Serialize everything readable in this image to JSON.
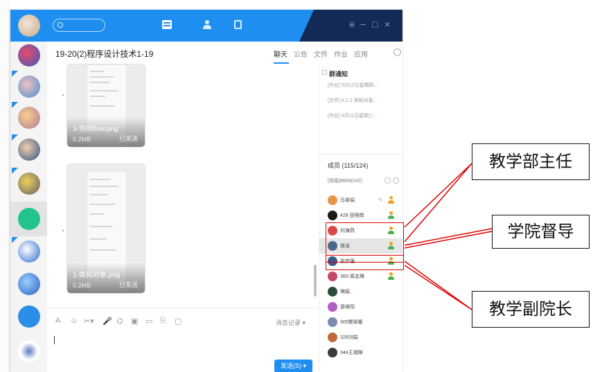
{
  "window": {
    "title": "19-20(2)程序设计技术1-19",
    "window_controls": [
      "≡",
      "−",
      "□",
      "×"
    ]
  },
  "tabs": [
    {
      "label": "聊天",
      "active": true
    },
    {
      "label": "公告",
      "active": false
    },
    {
      "label": "文件",
      "active": false
    },
    {
      "label": "作业",
      "active": false
    },
    {
      "label": "应用",
      "active": false
    }
  ],
  "messages": [
    {
      "filename": "3-协同flow.png",
      "size": "0.2MB",
      "status": "已发送"
    },
    {
      "filename": "1-类和对象.png",
      "size": "0.2MB",
      "status": "已发送"
    }
  ],
  "toolbar": {
    "icons": [
      "A",
      "☺",
      "✂▾",
      "🎤",
      "⌬",
      "▣",
      "▭",
      "⎘",
      "▢"
    ],
    "history_label": "消息记录 ▾",
    "send_label": "发送(S) ▾"
  },
  "group_notice": {
    "title": "群通知",
    "items": [
      "[作业] 3月12日星期四...",
      "[文件] 6.1-2 类和对象...",
      "[作业] 3月11日星期三..."
    ]
  },
  "members": {
    "title": "成员 (115/124)",
    "search_label": "[班级]#8#8(242)",
    "list": [
      {
        "name": "马翠娟",
        "role": "owner",
        "avatar_color": "#e8944a"
      },
      {
        "name": "428 田明辉",
        "role": "admin",
        "avatar_color": "#1a1a1a"
      },
      {
        "name": "刘海燕",
        "role": "admin",
        "avatar_color": "#d84a4a"
      },
      {
        "name": "徐洁",
        "role": "admin",
        "avatar_color": "#4a6a8a"
      },
      {
        "name": "张宗强",
        "role": "admin",
        "avatar_color": "#3a5a8a"
      },
      {
        "name": "360-周志琳",
        "role": "admin",
        "avatar_color": "#c04a6a"
      },
      {
        "name": "琳娟",
        "role": "none",
        "avatar_color": "#2a4a3a"
      },
      {
        "name": "游境阳",
        "role": "none",
        "avatar_color": "#b060c0"
      },
      {
        "name": "305樊翠娜",
        "role": "none",
        "avatar_color": "#7a8ab0"
      },
      {
        "name": "328刘娟",
        "role": "none",
        "avatar_color": "#c06a3a"
      },
      {
        "name": "344王湘琳",
        "role": "none",
        "avatar_color": "#3a3a3a"
      }
    ]
  },
  "annotations": [
    {
      "label": "教学部主任"
    },
    {
      "label": "学院督导"
    },
    {
      "label": "教学副院长"
    }
  ],
  "colors": {
    "brand_blue": "#1e8ff0",
    "title_dark": "#132a57",
    "annotation_red": "#e00000"
  }
}
